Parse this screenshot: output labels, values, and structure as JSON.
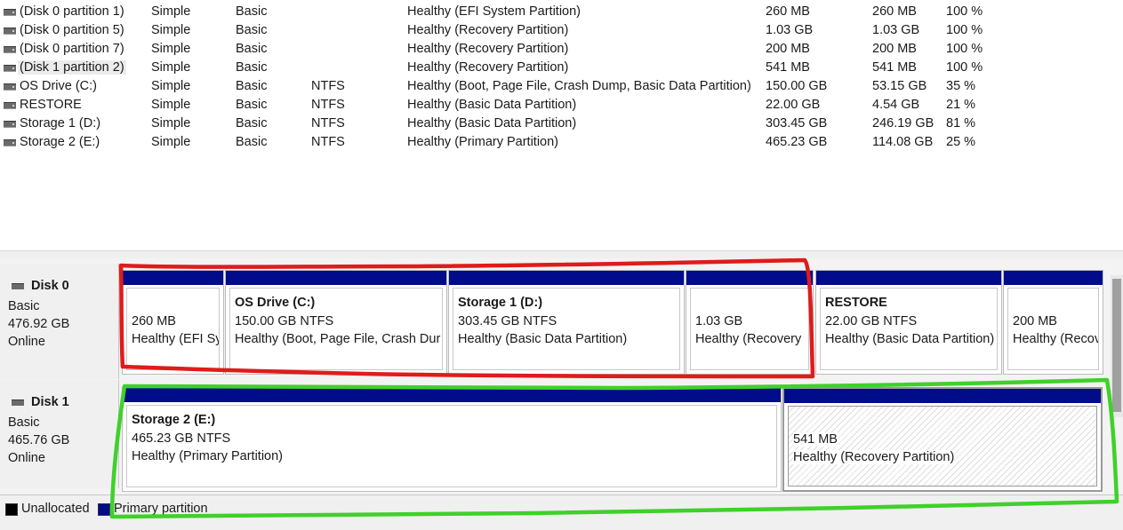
{
  "volumes": [
    {
      "volume": "(Disk 0 partition 1)",
      "layout": "Simple",
      "type": "Basic",
      "fs": "",
      "status": "Healthy (EFI System Partition)",
      "capacity": "260 MB",
      "free": "260 MB",
      "pct": "100 %"
    },
    {
      "volume": "(Disk 0 partition 5)",
      "layout": "Simple",
      "type": "Basic",
      "fs": "",
      "status": "Healthy (Recovery Partition)",
      "capacity": "1.03 GB",
      "free": "1.03 GB",
      "pct": "100 %"
    },
    {
      "volume": "(Disk 0 partition 7)",
      "layout": "Simple",
      "type": "Basic",
      "fs": "",
      "status": "Healthy (Recovery Partition)",
      "capacity": "200 MB",
      "free": "200 MB",
      "pct": "100 %"
    },
    {
      "volume": "(Disk 1 partition 2)",
      "layout": "Simple",
      "type": "Basic",
      "fs": "",
      "status": "Healthy (Recovery Partition)",
      "capacity": "541 MB",
      "free": "541 MB",
      "pct": "100 %"
    },
    {
      "volume": "OS Drive (C:)",
      "layout": "Simple",
      "type": "Basic",
      "fs": "NTFS",
      "status": "Healthy (Boot, Page File, Crash Dump, Basic Data Partition)",
      "capacity": "150.00 GB",
      "free": "53.15 GB",
      "pct": "35 %"
    },
    {
      "volume": "RESTORE",
      "layout": "Simple",
      "type": "Basic",
      "fs": "NTFS",
      "status": "Healthy (Basic Data Partition)",
      "capacity": "22.00 GB",
      "free": "4.54 GB",
      "pct": "21 %"
    },
    {
      "volume": "Storage 1 (D:)",
      "layout": "Simple",
      "type": "Basic",
      "fs": "NTFS",
      "status": "Healthy (Basic Data Partition)",
      "capacity": "303.45 GB",
      "free": "246.19 GB",
      "pct": "81 %"
    },
    {
      "volume": "Storage 2 (E:)",
      "layout": "Simple",
      "type": "Basic",
      "fs": "NTFS",
      "status": "Healthy (Primary Partition)",
      "capacity": "465.23 GB",
      "free": "114.08 GB",
      "pct": "25 %"
    }
  ],
  "disks": [
    {
      "name": "Disk 0",
      "type": "Basic",
      "size": "476.92 GB",
      "state": "Online",
      "partitions": [
        {
          "title": "",
          "size": "260 MB",
          "status": "Healthy (EFI Sy"
        },
        {
          "title": "OS Drive  (C:)",
          "size": "150.00 GB NTFS",
          "status": "Healthy (Boot, Page File, Crash Dur"
        },
        {
          "title": "Storage 1  (D:)",
          "size": "303.45 GB NTFS",
          "status": "Healthy (Basic Data Partition)"
        },
        {
          "title": "",
          "size": "1.03 GB",
          "status": "Healthy (Recovery"
        },
        {
          "title": "RESTORE",
          "size": "22.00 GB NTFS",
          "status": "Healthy (Basic Data Partition)"
        },
        {
          "title": "",
          "size": "200 MB",
          "status": "Healthy (Recov"
        }
      ]
    },
    {
      "name": "Disk 1",
      "type": "Basic",
      "size": "465.76 GB",
      "state": "Online",
      "partitions": [
        {
          "title": "Storage 2  (E:)",
          "size": "465.23 GB NTFS",
          "status": "Healthy (Primary Partition)"
        },
        {
          "title": "",
          "size": "541 MB",
          "status": "Healthy (Recovery Partition)"
        }
      ]
    }
  ],
  "legend": {
    "unallocated": "Unallocated",
    "primary": "Primary partition",
    "unallocated_color": "#000000",
    "primary_color": "#000c8a"
  },
  "colors": {
    "partition_bar": "#000c8a",
    "annotation_red": "#e01b1b",
    "annotation_green": "#3fd12a"
  }
}
